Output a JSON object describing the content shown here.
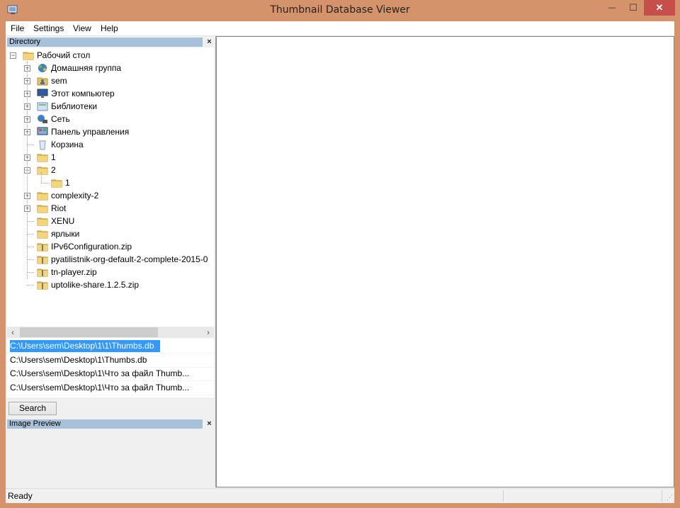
{
  "window": {
    "title": "Thumbnail Database Viewer",
    "close_glyph": "✕",
    "min_glyph": "—",
    "max_glyph": "☐",
    "accent_color": "#d5936b",
    "close_color": "#c74f4a"
  },
  "menu": {
    "items": [
      "File",
      "Settings",
      "View",
      "Help"
    ]
  },
  "directory_panel": {
    "title": "Directory",
    "close_glyph": "×",
    "tree": [
      {
        "label": "Рабочий стол",
        "icon": "folder-icon",
        "level": 0,
        "expander": "−"
      },
      {
        "label": "Домашняя группа",
        "icon": "homegroup-icon",
        "level": 1,
        "expander": "+"
      },
      {
        "label": "sem",
        "icon": "user-folder-icon",
        "level": 1,
        "expander": "+"
      },
      {
        "label": "Этот компьютер",
        "icon": "computer-icon",
        "level": 1,
        "expander": "+"
      },
      {
        "label": "Библиотеки",
        "icon": "libraries-icon",
        "level": 1,
        "expander": "+"
      },
      {
        "label": "Сеть",
        "icon": "network-icon",
        "level": 1,
        "expander": "+"
      },
      {
        "label": "Панель управления",
        "icon": "control-panel-icon",
        "level": 1,
        "expander": "+"
      },
      {
        "label": "Корзина",
        "icon": "recycle-bin-icon",
        "level": 1,
        "expander": ""
      },
      {
        "label": "1",
        "icon": "folder-icon",
        "level": 1,
        "expander": "+"
      },
      {
        "label": "2",
        "icon": "folder-icon",
        "level": 1,
        "expander": "−"
      },
      {
        "label": "1",
        "icon": "folder-icon",
        "level": 2,
        "expander": ""
      },
      {
        "label": "complexity-2",
        "icon": "folder-icon",
        "level": 1,
        "expander": "+"
      },
      {
        "label": "Riot",
        "icon": "folder-icon",
        "level": 1,
        "expander": "+"
      },
      {
        "label": "XENU",
        "icon": "folder-icon",
        "level": 1,
        "expander": ""
      },
      {
        "label": "ярлыки",
        "icon": "folder-icon",
        "level": 1,
        "expander": ""
      },
      {
        "label": "IPv6Configuration.zip",
        "icon": "zip-folder-icon",
        "level": 1,
        "expander": ""
      },
      {
        "label": "pyatilistnik-org-default-2-complete-2015-0",
        "icon": "zip-folder-icon",
        "level": 1,
        "expander": ""
      },
      {
        "label": "tn-player.zip",
        "icon": "zip-folder-icon",
        "level": 1,
        "expander": ""
      },
      {
        "label": "uptolike-share.1.2.5.zip",
        "icon": "zip-folder-icon",
        "level": 1,
        "expander": ""
      }
    ]
  },
  "results": {
    "items": [
      {
        "path": "C:\\Users\\sem\\Desktop\\1\\1\\Thumbs.db",
        "selected": true
      },
      {
        "path": "C:\\Users\\sem\\Desktop\\1\\Thumbs.db",
        "selected": false
      },
      {
        "path": "C:\\Users\\sem\\Desktop\\1\\Что за файл Thumb...",
        "selected": false
      },
      {
        "path": "C:\\Users\\sem\\Desktop\\1\\Что за файл Thumb...",
        "selected": false
      }
    ],
    "selected_color": "#3399ff"
  },
  "search_button": {
    "label": "Search"
  },
  "preview_panel": {
    "title": "Image Preview",
    "close_glyph": "×"
  },
  "status": {
    "text": "Ready"
  }
}
